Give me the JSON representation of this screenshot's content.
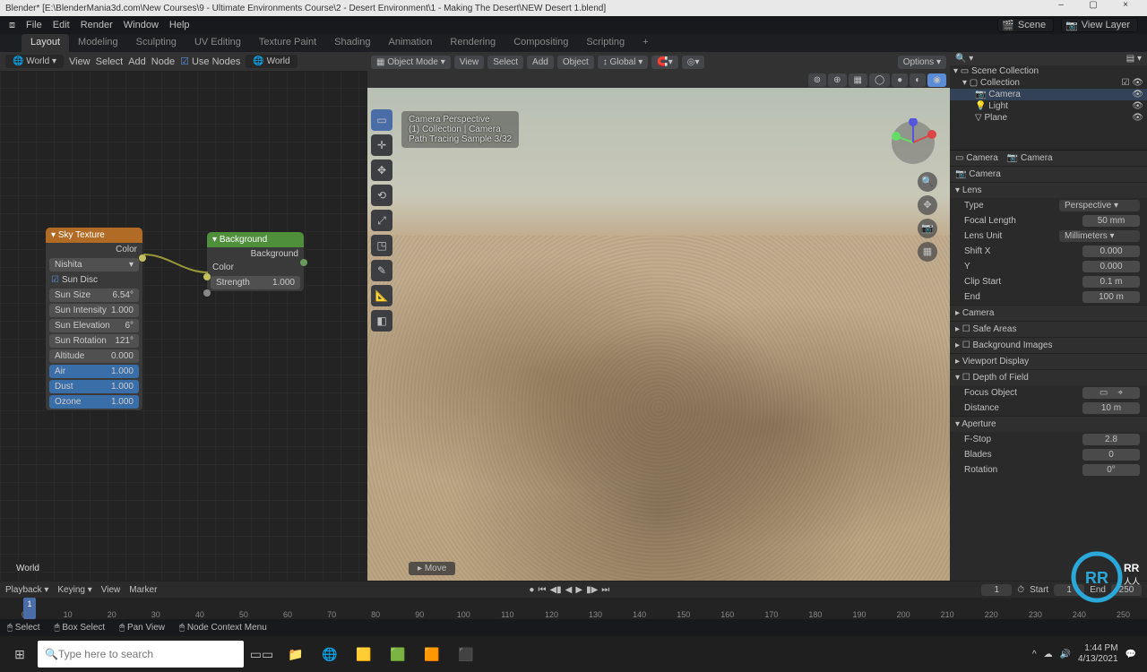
{
  "window": {
    "title": "Blender* [E:\\BlenderMania3d.com\\New Courses\\9 - Ultimate Environments Course\\2 - Desert Environment\\1 - Making The Desert\\NEW Desert 1.blend]",
    "minimize": "–",
    "maximize": "▢",
    "close": "×"
  },
  "topmenu": {
    "blender_icon": "⧈",
    "items": [
      "File",
      "Edit",
      "Render",
      "Window",
      "Help"
    ],
    "scene_label": "Scene",
    "scene_value": "Scene",
    "layer_label": "View Layer",
    "layer_value": "View Layer"
  },
  "workspace_tabs": [
    "Layout",
    "Modeling",
    "Sculpting",
    "UV Editing",
    "Texture Paint",
    "Shading",
    "Animation",
    "Rendering",
    "Compositing",
    "Scripting"
  ],
  "workspace_active": "Layout",
  "node_header": {
    "mode": "World",
    "menus": [
      "View",
      "Select",
      "Add",
      "Node"
    ],
    "use_nodes": "Use Nodes",
    "world_slot": "World"
  },
  "node_footer": "World",
  "sky_node": {
    "title": "Sky Texture",
    "out": "Color",
    "sky_model": "Nishita",
    "sun_disc": "Sun Disc",
    "fields": [
      {
        "k": "Sun Size",
        "v": "6.54°"
      },
      {
        "k": "Sun Intensity",
        "v": "1.000"
      },
      {
        "k": "Sun Elevation",
        "v": "6°"
      },
      {
        "k": "Sun Rotation",
        "v": "121°"
      },
      {
        "k": "Altitude",
        "v": "0.000"
      },
      {
        "k": "Air",
        "v": "1.000"
      },
      {
        "k": "Dust",
        "v": "1.000"
      },
      {
        "k": "Ozone",
        "v": "1.000"
      }
    ]
  },
  "bg_node": {
    "title": "Background",
    "out": "Background",
    "color_label": "Color",
    "strength_label": "Strength",
    "strength_value": "1.000"
  },
  "viewport": {
    "mode": "Object Mode",
    "menus": [
      "View",
      "Select",
      "Add",
      "Object"
    ],
    "orient": "Global",
    "options": "Options",
    "overlay_title": "Camera Perspective",
    "overlay_line1": "(1) Collection | Camera",
    "overlay_line2": "Path Tracing Sample 3/32",
    "bottom_hint": "Move"
  },
  "outliner": {
    "header": "Scene Collection",
    "items": [
      {
        "name": "Collection",
        "depth": 1
      },
      {
        "name": "Camera",
        "depth": 2,
        "sel": true
      },
      {
        "name": "Light",
        "depth": 2
      },
      {
        "name": "Plane",
        "depth": 2
      }
    ]
  },
  "properties": {
    "tab1": "Camera",
    "tab2": "Camera",
    "obj": "Camera",
    "lens_panel": "Lens",
    "fields": [
      {
        "k": "Type",
        "v": "Perspective",
        "sel": true
      },
      {
        "k": "Focal Length",
        "v": "50 mm"
      },
      {
        "k": "Lens Unit",
        "v": "Millimeters",
        "sel": true
      },
      {
        "k": "Shift X",
        "v": "0.000"
      },
      {
        "k": "Y",
        "v": "0.000"
      },
      {
        "k": "Clip Start",
        "v": "0.1 m"
      },
      {
        "k": "End",
        "v": "100 m"
      }
    ],
    "panels": [
      "Camera",
      "Safe Areas",
      "Background Images",
      "Viewport Display",
      "Depth of Field"
    ],
    "dof": {
      "focus_object_label": "Focus Object",
      "focus_object_val": "",
      "distance_label": "Distance",
      "distance_val": "10 m",
      "aperture": "Aperture",
      "fstop_label": "F-Stop",
      "fstop_val": "2.8",
      "blades_label": "Blades",
      "blades_val": "0",
      "rotation_label": "Rotation",
      "rotation_val": "0°"
    }
  },
  "timeline": {
    "menus": [
      "Playback",
      "Keying",
      "View",
      "Marker"
    ],
    "playback_icon": "●",
    "frames": [
      "0",
      "10",
      "20",
      "30",
      "40",
      "50",
      "60",
      "70",
      "80",
      "90",
      "100",
      "110",
      "120",
      "130",
      "140",
      "150",
      "160",
      "170",
      "180",
      "190",
      "200",
      "210",
      "220",
      "230",
      "240",
      "250"
    ],
    "current": "1",
    "start_label": "Start",
    "start": "1",
    "end_label": "End",
    "end": "250"
  },
  "status": {
    "select": "Select",
    "box": "Box Select",
    "pan": "Pan View",
    "ctx": "Node Context Menu"
  },
  "taskbar": {
    "start": "⊞",
    "search_placeholder": "Type here to search",
    "time": "1:44 PM",
    "date": "4/13/2021"
  }
}
